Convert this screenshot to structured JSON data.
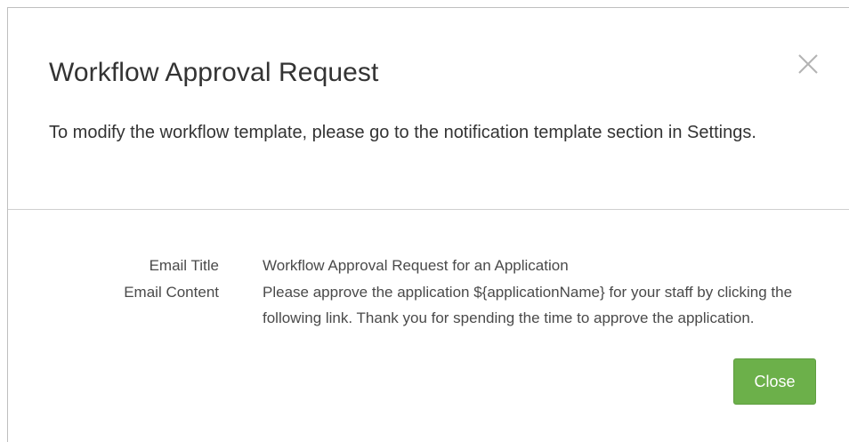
{
  "dialog": {
    "title": "Workflow Approval Request",
    "description": "To modify the workflow template, please go to the notification template section in Settings.",
    "close_icon": "close-x-icon"
  },
  "details": {
    "email_title_label": "Email Title",
    "email_title_value": "Workflow Approval Request for an Application",
    "email_content_label": "Email Content",
    "email_content_value": "Please approve the application ${applicationName} for your staff by clicking the following link. Thank you for spending the time to approve the application."
  },
  "footer": {
    "close_label": "Close"
  },
  "colors": {
    "primary_button": "#6cb04a",
    "text": "#333333",
    "divider": "#d0d0d0"
  }
}
